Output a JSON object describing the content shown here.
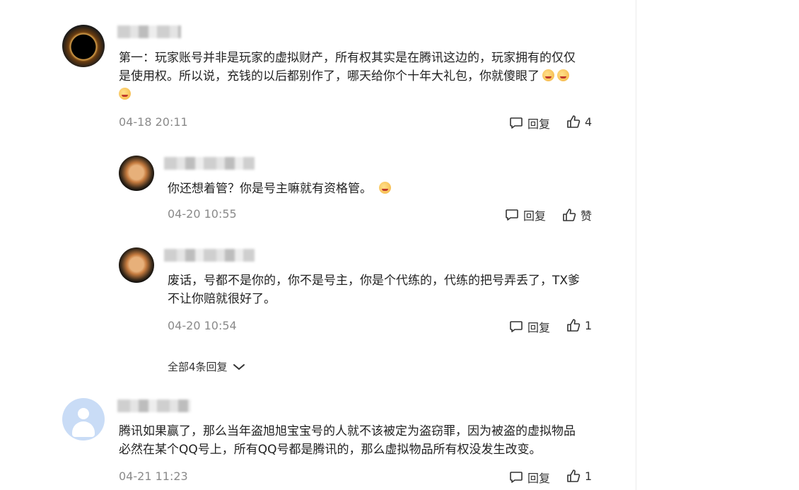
{
  "comments": [
    {
      "text_lines": [
        "第一：玩家账号并非是玩家的虚拟财产，所有权其实是在腾讯这边的，玩家拥有的仅仅",
        "是使用权。所以说，充钱的以后都别作了，哪天给你个十年大礼包，你就傻眼了"
      ],
      "time": "04-18 20:11",
      "reply_label": "回复",
      "likes": "4",
      "avatar_icon": "eclipse-avatar"
    },
    {
      "text_lines": [
        "你还想着管？你是号主嘛就有资格管。"
      ],
      "time": "04-20 10:55",
      "reply_label": "回复",
      "likes": "赞",
      "avatar_icon": "dog-avatar"
    },
    {
      "text_lines": [
        "废话，号都不是你的，你不是号主，你是个代练的，代练的把号弄丢了，TX爹",
        "不让你赔就很好了。"
      ],
      "time": "04-20 10:54",
      "reply_label": "回复",
      "likes": "1",
      "avatar_icon": "dog-avatar"
    },
    {
      "text_lines": [
        "腾讯如果赢了，那么当年盗旭旭宝宝号的人就不该被定为盗窃罪，因为被盗的虚拟物品",
        "必然在某个QQ号上，所有QQ号都是腾讯的，那么虚拟物品所有权没发生改变。"
      ],
      "time": "04-21 11:23",
      "reply_label": "回复",
      "likes": "1",
      "avatar_icon": "default-avatar"
    }
  ],
  "expand_replies_label": "全部4条回复",
  "colors": {
    "text": "#222222",
    "meta": "#8a8a8a",
    "divider": "#ececec"
  }
}
